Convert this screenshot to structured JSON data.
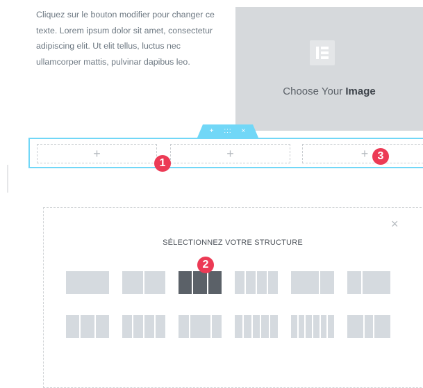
{
  "content": {
    "paragraph": "Cliquez sur le bouton modifier pour changer ce texte. Lorem ipsum dolor sit amet, consectetur adipiscing elit. Ut elit tellus, luctus nec ullamcorper mattis, pulvinar dapibus leo.",
    "image_placeholder": {
      "prefix": "Choose Your ",
      "bold": "Image"
    }
  },
  "section_handle": {
    "add": "+",
    "drag": ":::",
    "delete": "×"
  },
  "columns": [
    {
      "add": "+"
    },
    {
      "add": "+"
    },
    {
      "add": "+"
    }
  ],
  "annotations": [
    "1",
    "2",
    "3"
  ],
  "structure_panel": {
    "title": "SÉLECTIONNEZ VOTRE STRUCTURE",
    "close": "×",
    "presets_row1": [
      "1 colonne",
      "2 colonnes",
      "3 colonnes",
      "4 colonnes",
      "2 colonnes",
      "2 colonnes"
    ],
    "presets_row2": [
      "3 colonnes",
      "4 colonnes",
      "3 colonnes",
      "5 colonnes",
      "6 colonnes",
      "3 colonnes"
    ],
    "selected": "3 colonnes"
  },
  "colors": {
    "accent": "#71d7f7",
    "badge": "#ec3a55",
    "preset": "#d5dadf",
    "preset_selected": "#5b6168"
  }
}
